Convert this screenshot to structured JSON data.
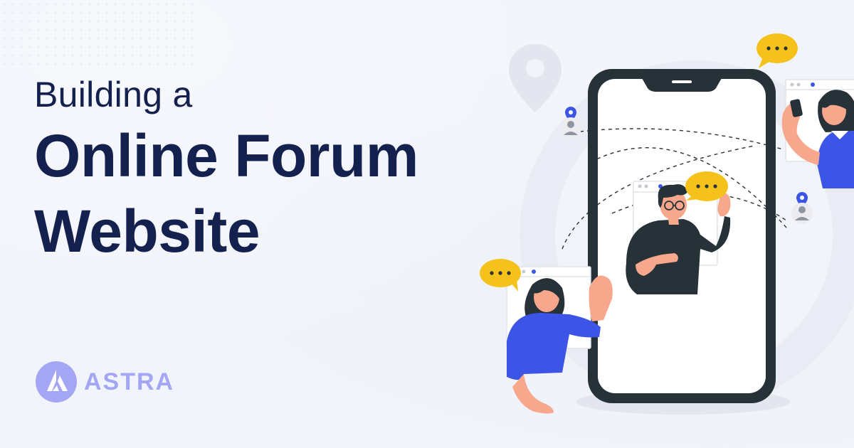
{
  "headline": {
    "line1": "Building a",
    "line2": "Online Forum",
    "line3": "Website"
  },
  "brand": {
    "name": "ASTRA"
  },
  "colors": {
    "navy": "#14214f",
    "brand_lavender": "#a3a6f4",
    "accent_blue": "#3d55e6",
    "bubble_yellow": "#f5c21b",
    "phone_dark": "#263238",
    "background": "#f2f4fb"
  },
  "icons": [
    "location-pin-icon",
    "speech-bubble-icon",
    "user-avatar-icon",
    "astra-logo-icon"
  ]
}
